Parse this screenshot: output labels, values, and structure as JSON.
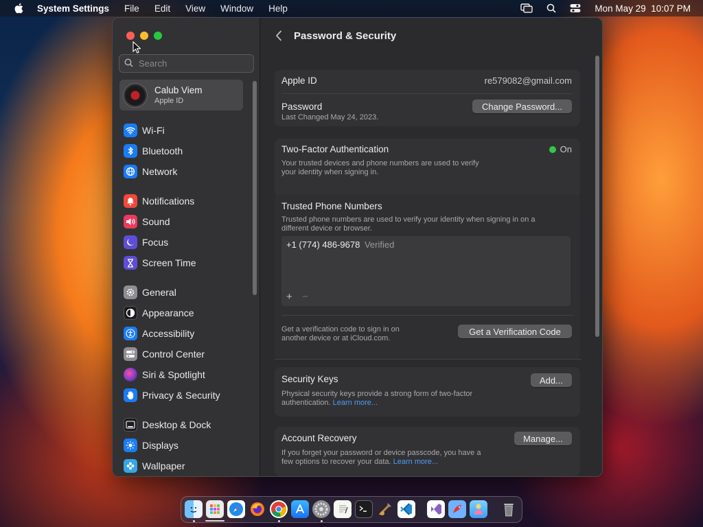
{
  "menubar": {
    "app_name": "System Settings",
    "items": [
      "File",
      "Edit",
      "View",
      "Window",
      "Help"
    ],
    "clock": "Mon May 29  10:07 PM"
  },
  "sidebar": {
    "search_placeholder": "Search",
    "account": {
      "name": "Calub Viem",
      "subtitle": "Apple ID"
    },
    "items": [
      {
        "label": "Wi-Fi",
        "icon": "wifi-icon",
        "color": "#1a7cf5"
      },
      {
        "label": "Bluetooth",
        "icon": "bluetooth-icon",
        "color": "#1a7cf5"
      },
      {
        "label": "Network",
        "icon": "globe-icon",
        "color": "#1a7cf5"
      },
      {
        "label": "Notifications",
        "icon": "bell-icon",
        "color": "#f1483c"
      },
      {
        "label": "Sound",
        "icon": "speaker-icon",
        "color": "#ea3a5e"
      },
      {
        "label": "Focus",
        "icon": "moon-icon",
        "color": "#5f4ed6"
      },
      {
        "label": "Screen Time",
        "icon": "hourglass-icon",
        "color": "#5f4ed6"
      },
      {
        "label": "General",
        "icon": "gear-icon",
        "color": "#8e8e93"
      },
      {
        "label": "Appearance",
        "icon": "appearance-icon",
        "color": "#1c1c1e"
      },
      {
        "label": "Accessibility",
        "icon": "accessibility-icon",
        "color": "#1a7cf5"
      },
      {
        "label": "Control Center",
        "icon": "toggles-icon",
        "color": "#8e8e93"
      },
      {
        "label": "Siri & Spotlight",
        "icon": "siri-icon",
        "color": "#7a3fc7"
      },
      {
        "label": "Privacy & Security",
        "icon": "hand-icon",
        "color": "#1a7cf5"
      },
      {
        "label": "Desktop & Dock",
        "icon": "dock-icon",
        "color": "#1c1c1e"
      },
      {
        "label": "Displays",
        "icon": "sun-icon",
        "color": "#1a7cf5"
      },
      {
        "label": "Wallpaper",
        "icon": "flower-icon",
        "color": "#35a6e8"
      }
    ]
  },
  "main": {
    "title": "Password & Security",
    "apple_id_label": "Apple ID",
    "apple_id_value": "re579082@gmail.com",
    "password_label": "Password",
    "password_changed": "Last Changed May 24, 2023.",
    "change_password_button": "Change Password...",
    "two_factor_label": "Two-Factor Authentication",
    "two_factor_status": "On",
    "two_factor_status_color": "#32c74a",
    "two_factor_desc_1": "Your trusted devices and phone numbers are used to verify",
    "two_factor_desc_2": "your identity when signing in.",
    "trusted_label": "Trusted Phone Numbers",
    "trusted_desc_1": "Trusted phone numbers are used to verify your identity when signing in on a",
    "trusted_desc_2": "different device or browser.",
    "phone_number": "+1 (774) 486-9678",
    "phone_status": "Verified",
    "add_symbol": "+",
    "remove_symbol": "−",
    "verification_desc_1": "Get a verification code to sign in on",
    "verification_desc_2": "another device or at iCloud.com.",
    "verification_button": "Get a Verification Code",
    "security_keys_label": "Security Keys",
    "security_keys_desc_1": "Physical security keys provide a strong form of two-factor",
    "security_keys_desc_2": "authentication.",
    "learn_more_1": "Learn more...",
    "add_button": "Add...",
    "account_recovery_label": "Account Recovery",
    "account_recovery_desc_1": "If you forget your password or device passcode, you have a",
    "account_recovery_desc_2": "few options to recover your data.",
    "learn_more_2": "Learn more...",
    "manage_button": "Manage..."
  },
  "dock": {
    "apps": [
      "finder-icon",
      "launchpad-icon",
      "safari-icon",
      "firefox-icon",
      "chrome-icon",
      "app-store-icon",
      "system-settings-icon",
      "textedit-icon",
      "terminal-icon",
      "xcode-instruments-icon",
      "vscode-icon",
      "visual-studio-icon",
      "parrot-icon",
      "preview-icon",
      "trash-icon"
    ]
  }
}
